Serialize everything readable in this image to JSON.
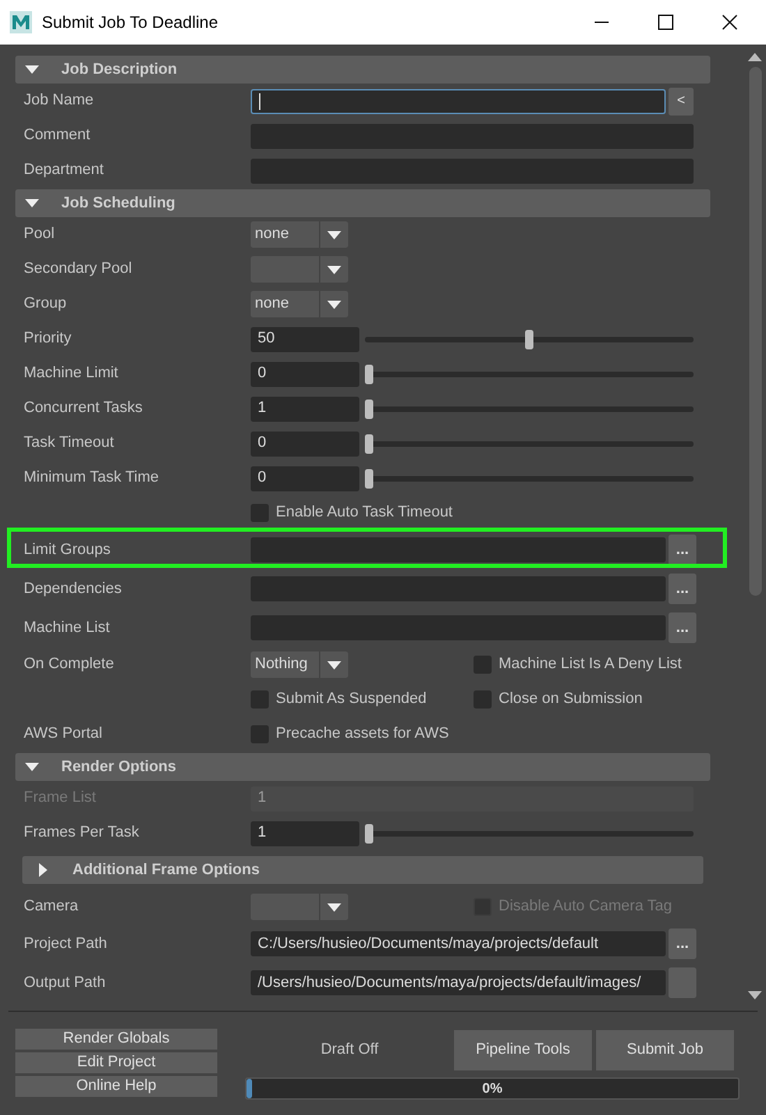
{
  "window": {
    "title": "Submit Job To Deadline"
  },
  "sections": [
    {
      "title": "Job Description",
      "expanded": true,
      "rows": [
        {
          "kind": "field",
          "label": "Job Name",
          "focused": true,
          "button": {
            "kind": "small",
            "label": "<"
          }
        },
        {
          "kind": "field",
          "label": "Comment"
        },
        {
          "kind": "field",
          "label": "Department"
        }
      ]
    },
    {
      "title": "Job Scheduling",
      "expanded": true,
      "rows": [
        {
          "kind": "dropdown",
          "label": "Pool",
          "value": "none"
        },
        {
          "kind": "dropdown",
          "label": "Secondary Pool"
        },
        {
          "kind": "dropdown",
          "label": "Group",
          "value": "none"
        },
        {
          "kind": "slider",
          "label": "Priority",
          "value": "50",
          "level": 0.5
        },
        {
          "kind": "slider",
          "label": "Machine Limit",
          "value": "0",
          "level": 0
        },
        {
          "kind": "slider",
          "label": "Concurrent Tasks",
          "value": "1",
          "level": 0
        },
        {
          "kind": "slider",
          "label": "Task Timeout",
          "value": "0",
          "level": 0
        },
        {
          "kind": "slider",
          "label": "Minimum Task Time",
          "value": "0",
          "level": 0
        },
        {
          "kind": "checks",
          "checks": [
            {
              "label": "Enable Auto Task Timeout",
              "checked": false
            }
          ]
        },
        {
          "kind": "field",
          "label": "Limit Groups",
          "highlighted": true,
          "button": {
            "kind": "browse",
            "label": "..."
          }
        },
        {
          "kind": "field",
          "label": "Dependencies",
          "button": {
            "kind": "browse",
            "label": "..."
          }
        },
        {
          "kind": "field",
          "label": "Machine List",
          "button": {
            "kind": "browse",
            "label": "..."
          }
        },
        {
          "kind": "dropdown",
          "label": "On Complete",
          "value": "Nothing",
          "check": {
            "label": "Machine List Is A Deny List",
            "checked": false
          }
        },
        {
          "kind": "checks",
          "checks": [
            {
              "label": "Submit As Suspended",
              "checked": false
            },
            {
              "label": "Close on Submission",
              "checked": false
            }
          ]
        },
        {
          "kind": "checks",
          "label": "AWS Portal",
          "checks": [
            {
              "label": "Precache assets for AWS",
              "checked": false
            }
          ]
        }
      ]
    },
    {
      "title": "Render Options",
      "expanded": true,
      "rows": [
        {
          "kind": "field",
          "label": "Frame List",
          "value": "1",
          "disabled": true
        },
        {
          "kind": "slider",
          "label": "Frames Per Task",
          "value": "1",
          "level": 0
        },
        {
          "kind": "subsection",
          "title": "Additional Frame Options",
          "expanded": false
        },
        {
          "kind": "dropdown",
          "label": "Camera",
          "check": {
            "label": "Disable Auto Camera Tag",
            "checked": false,
            "disabled": true
          }
        },
        {
          "kind": "field",
          "label": "Project Path",
          "value": "C:/Users/husieo/Documents/maya/projects/default",
          "button": {
            "kind": "browse",
            "label": "..."
          }
        },
        {
          "kind": "field",
          "label": "Output Path",
          "value": "/Users/husieo/Documents/maya/projects/default/images/",
          "button": {
            "kind": "browse"
          }
        }
      ]
    }
  ],
  "footer": {
    "side_buttons": [
      "Render Globals",
      "Edit Project",
      "Online Help"
    ],
    "draft_status": "Draft Off",
    "buttons": [
      "Pipeline Tools",
      "Submit Job"
    ],
    "progress": {
      "level": 0.01,
      "label": "0%"
    }
  }
}
